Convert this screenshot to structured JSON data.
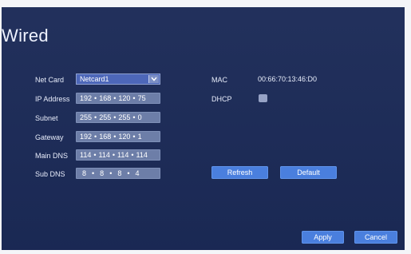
{
  "window": {
    "title": "Wired"
  },
  "form": {
    "net_card": {
      "label": "Net Card",
      "value": "Netcard1"
    },
    "ip_address": {
      "label": "IP Address",
      "octets": [
        "192",
        "168",
        "120",
        "75"
      ]
    },
    "subnet": {
      "label": "Subnet",
      "octets": [
        "255",
        "255",
        "255",
        "0"
      ]
    },
    "gateway": {
      "label": "Gateway",
      "octets": [
        "192",
        "168",
        "120",
        "1"
      ]
    },
    "main_dns": {
      "label": "Main DNS",
      "octets": [
        "114",
        "114",
        "114",
        "114"
      ]
    },
    "sub_dns": {
      "label": "Sub DNS",
      "octets": [
        "8",
        "8",
        "8",
        "4"
      ]
    },
    "mac": {
      "label": "MAC",
      "value": "00:66:70:13:46:D0"
    },
    "dhcp": {
      "label": "DHCP",
      "checked": false
    }
  },
  "buttons": {
    "refresh": "Refresh",
    "default": "Default",
    "apply": "Apply",
    "cancel": "Cancel"
  },
  "icons": {
    "dropdown": "chevron-down-icon",
    "dhcp_checkbox": "checkbox-icon"
  },
  "colors": {
    "panel": "#1b2a57",
    "field": "#6d7ea8",
    "dropdown": "#4d67b9",
    "button": "#4a7fde"
  }
}
